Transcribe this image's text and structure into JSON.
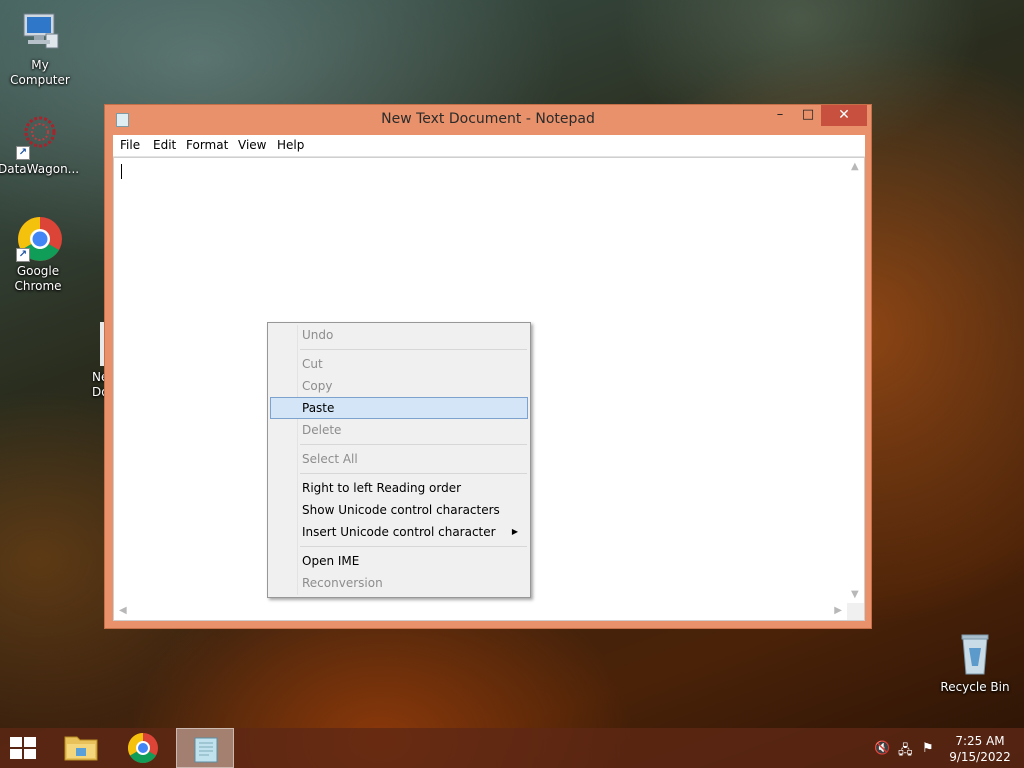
{
  "desktop": {
    "icons": [
      {
        "label": "My Computer"
      },
      {
        "label": "DataWagon..."
      },
      {
        "label": "Google\nChrome"
      },
      {
        "label": "Recycle Bin"
      }
    ],
    "partial_icon_label": "Ne\nDo"
  },
  "window": {
    "title": "New Text Document - Notepad",
    "controls": {
      "minimize": "–",
      "maximize": "□",
      "close": "✕"
    },
    "menu": [
      "File",
      "Edit",
      "Format",
      "View",
      "Help"
    ],
    "content": ""
  },
  "context_menu": {
    "items": [
      {
        "label": "Undo",
        "enabled": false
      },
      {
        "label": "Cut",
        "enabled": false
      },
      {
        "label": "Copy",
        "enabled": false
      },
      {
        "label": "Paste",
        "enabled": true,
        "highlighted": true
      },
      {
        "label": "Delete",
        "enabled": false
      },
      {
        "label": "Select All",
        "enabled": false
      },
      {
        "label": "Right to left Reading order",
        "enabled": true
      },
      {
        "label": "Show Unicode control characters",
        "enabled": true
      },
      {
        "label": "Insert Unicode control character",
        "enabled": true,
        "submenu": true
      },
      {
        "label": "Open IME",
        "enabled": true
      },
      {
        "label": "Reconversion",
        "enabled": false
      }
    ]
  },
  "taskbar": {
    "clock_time": "7:25 AM",
    "clock_date": "9/15/2022"
  },
  "colors": {
    "window_frame": "#e8916a",
    "close_button": "#c7503f",
    "menu_highlight": "#d4e5f7"
  }
}
